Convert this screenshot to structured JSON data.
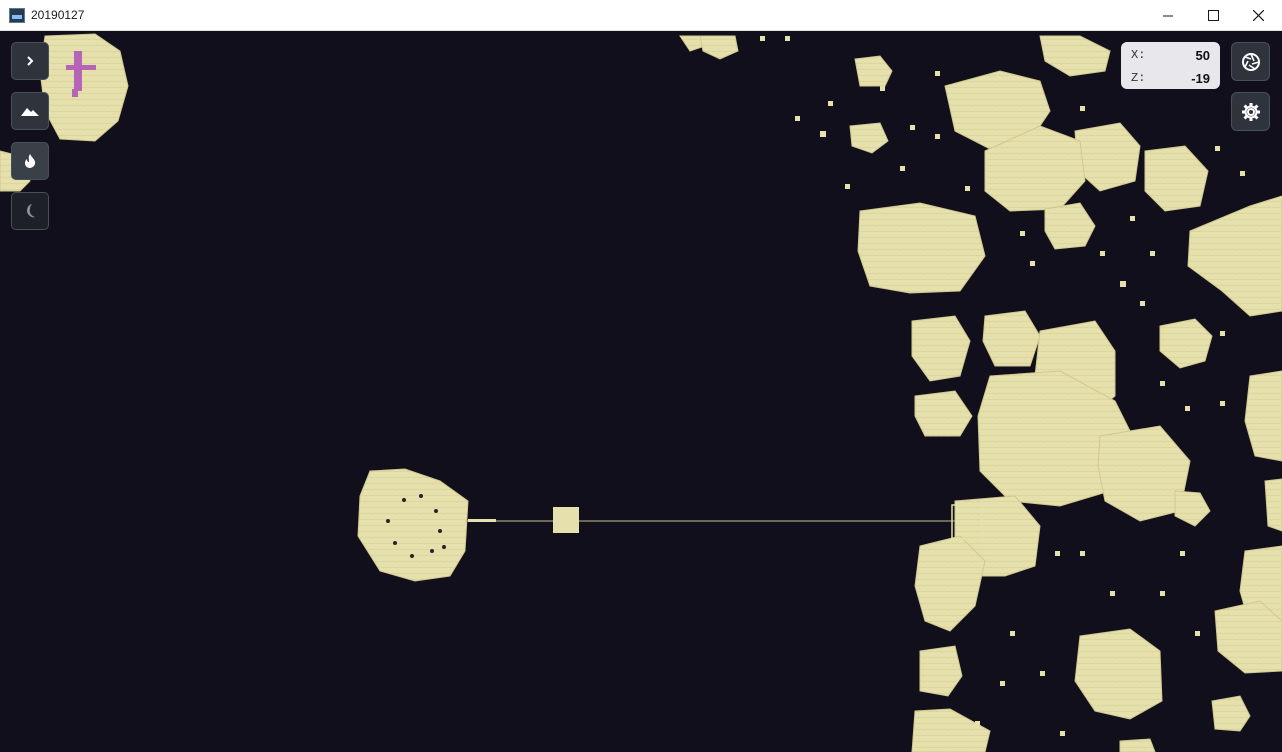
{
  "window": {
    "title": "20190127",
    "controls": [
      "minimize",
      "maximize",
      "close"
    ]
  },
  "toolbar": {
    "buttons": [
      {
        "name": "expand-panel",
        "icon": "chevron-right-icon",
        "state": "normal"
      },
      {
        "name": "surface-map",
        "icon": "mountain-icon",
        "state": "normal"
      },
      {
        "name": "nether-map",
        "icon": "flame-icon",
        "state": "active"
      },
      {
        "name": "end-map",
        "icon": "moon-icon",
        "state": "disabled"
      }
    ]
  },
  "coordinates": {
    "x_label": "X:",
    "x_value": "50",
    "z_label": "Z:",
    "z_value": "-19"
  },
  "side_buttons": [
    {
      "name": "screenshot",
      "icon": "camera-shutter-icon"
    },
    {
      "name": "settings",
      "icon": "gear-icon"
    }
  ],
  "colors": {
    "void": "#110f1c",
    "end_stone": "#e6e0ac",
    "end_stone_dark": "#cfc88f",
    "chorus": "#b565b7",
    "button_bg": "#2f343c"
  }
}
